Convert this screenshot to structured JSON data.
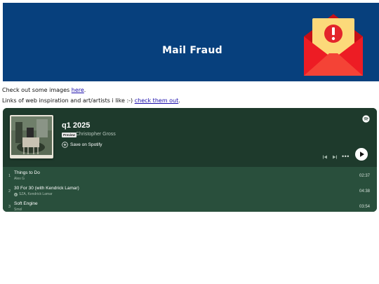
{
  "banner": {
    "title": "Mail Fraud"
  },
  "intro": {
    "line1_prefix": "Check out some images ",
    "line1_link": "here",
    "line1_suffix": ".",
    "line2_prefix": "Links of web inspiration and art/artists i like :-) ",
    "line2_link": "check them out",
    "line2_suffix": "."
  },
  "player": {
    "title": "q1 2025",
    "badge": "Preview",
    "owner": "Christopher Gross",
    "save_label": "Save on Spotify",
    "more_label": "•••",
    "tracks": [
      {
        "num": "1",
        "title": "Things to Do",
        "artist": "Alex G",
        "explicit": false,
        "duration": "02:37"
      },
      {
        "num": "2",
        "title": "30 For 30 (with Kendrick Lamar)",
        "artist": "SZA, Kendrick Lamar",
        "explicit": true,
        "explicit_mark": "E",
        "duration": "04:38"
      },
      {
        "num": "3",
        "title": "Soft Engine",
        "artist": "Smol",
        "explicit": false,
        "duration": "03:54"
      }
    ]
  },
  "colors": {
    "banner_bg": "#07407d",
    "player_bg": "#1e3a2c",
    "tracklist_bg": "#294f3c",
    "envelope_red": "#e0191d",
    "warning_yellow": "#fcd97a"
  }
}
